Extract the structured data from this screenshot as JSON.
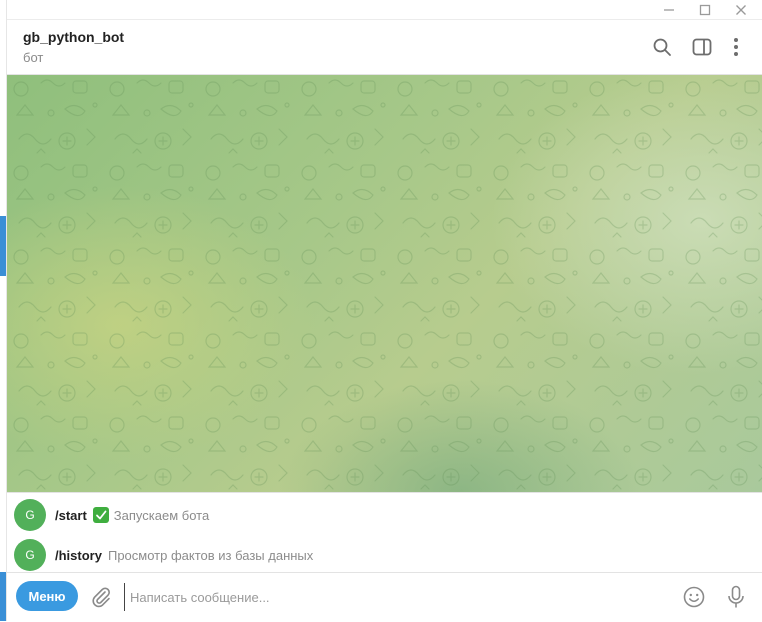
{
  "window": {
    "controls": [
      "minimize-icon",
      "maximize-icon",
      "close-icon"
    ]
  },
  "header": {
    "title": "gb_python_bot",
    "subtitle": "бот",
    "icons": [
      "search-icon",
      "side-panel-icon",
      "more-icon"
    ]
  },
  "commands": [
    {
      "avatar": "G",
      "name": "/start",
      "emoji": "✅",
      "description": "Запускаем бота"
    },
    {
      "avatar": "G",
      "name": "/history",
      "description": "Просмотр фактов из базы данных"
    }
  ],
  "composer": {
    "menu_label": "Меню",
    "placeholder": "Написать сообщение...",
    "value": ""
  },
  "colors": {
    "accent": "#3a9ae0",
    "avatar": "#52b05a",
    "chat_background": "#a7c889"
  }
}
